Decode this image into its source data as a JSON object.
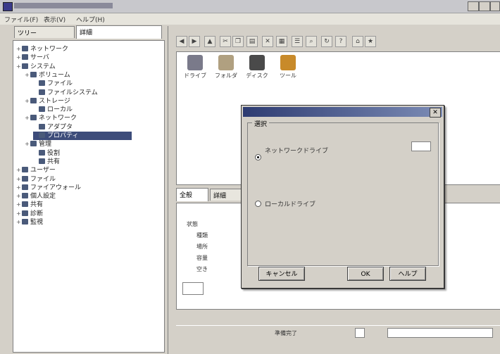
{
  "window": {
    "menu": [
      "ファイル(F)",
      "表示(V)",
      "ヘルプ(H)"
    ]
  },
  "left_tabs": [
    "ツリー",
    "詳細"
  ],
  "tree": [
    {
      "label": "ネットワーク",
      "level": 0
    },
    {
      "label": "サーバ",
      "level": 0
    },
    {
      "label": "システム",
      "level": 0
    },
    {
      "label": "ボリューム",
      "level": 1
    },
    {
      "label": "ファイル",
      "level": 2
    },
    {
      "label": "ファイルシステム",
      "level": 2
    },
    {
      "label": "ストレージ",
      "level": 1
    },
    {
      "label": "ローカル",
      "level": 2
    },
    {
      "label": "ネットワーク",
      "level": 1
    },
    {
      "label": "アダプタ",
      "level": 2
    },
    {
      "label": "プロパティ",
      "level": 2
    },
    {
      "label": "管理",
      "level": 1
    },
    {
      "label": "役割",
      "level": 2
    },
    {
      "label": "共有",
      "level": 2
    },
    {
      "label": "ユーザー",
      "level": 0
    },
    {
      "label": "ファイル",
      "level": 0
    },
    {
      "label": "ファイアウォール",
      "level": 0
    },
    {
      "label": "個人設定",
      "level": 0
    },
    {
      "label": "共有",
      "level": 0
    },
    {
      "label": "診断",
      "level": 0
    },
    {
      "label": "監視",
      "level": 0
    }
  ],
  "icons": [
    {
      "label": "ドライブ",
      "icon": "drive-icon",
      "color": "#7a7a8a"
    },
    {
      "label": "フォルダ",
      "icon": "folder-icon",
      "color": "#b0a080"
    },
    {
      "label": "ディスク",
      "icon": "disk-icon",
      "color": "#4a4a4a"
    },
    {
      "label": "ツール",
      "icon": "tool-icon",
      "color": "#c88a2a"
    }
  ],
  "bottom_tabs": [
    "全般",
    "詳細"
  ],
  "bottom_labels": [
    "状態",
    "種類",
    "場所",
    "容量",
    "空き"
  ],
  "dialog": {
    "group_label": "選択",
    "option1": "ネットワークドライブ",
    "option2": "ローカルドライブ",
    "cancel": "キャンセル",
    "ok": "OK",
    "help": "ヘルプ"
  },
  "status": {
    "text": "準備完了"
  }
}
